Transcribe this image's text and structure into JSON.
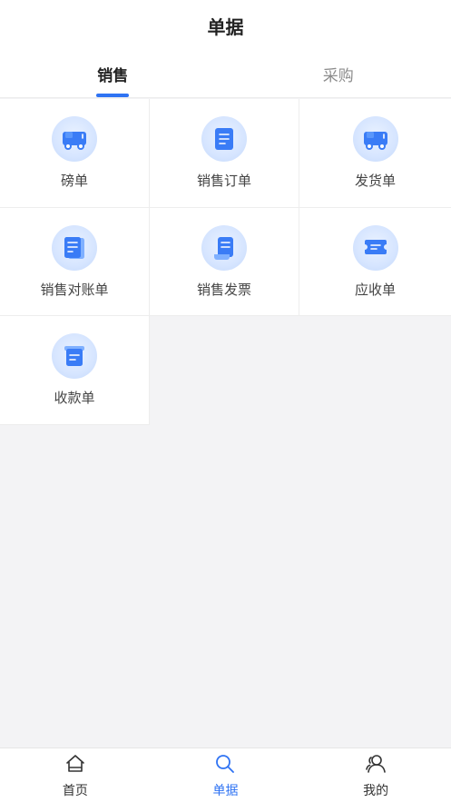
{
  "header": {
    "title": "单据"
  },
  "tabs": [
    {
      "label": "销售",
      "active": true
    },
    {
      "label": "采购",
      "active": false
    }
  ],
  "grid": [
    {
      "label": "磅单",
      "icon": "truck-icon"
    },
    {
      "label": "销售订单",
      "icon": "document-icon"
    },
    {
      "label": "发货单",
      "icon": "truck-icon"
    },
    {
      "label": "销售对账单",
      "icon": "ledger-icon"
    },
    {
      "label": "销售发票",
      "icon": "invoice-scroll-icon"
    },
    {
      "label": "应收单",
      "icon": "ticket-icon"
    },
    {
      "label": "收款单",
      "icon": "receipt-icon"
    }
  ],
  "bottom_nav": [
    {
      "label": "首页",
      "icon": "home-icon",
      "active": false
    },
    {
      "label": "单据",
      "icon": "search-icon",
      "active": true
    },
    {
      "label": "我的",
      "icon": "user-icon",
      "active": false
    }
  ],
  "colors": {
    "accent": "#2f73f3",
    "icon_bg": "#d6e5ff",
    "icon_fg": "#3a7cf6"
  }
}
